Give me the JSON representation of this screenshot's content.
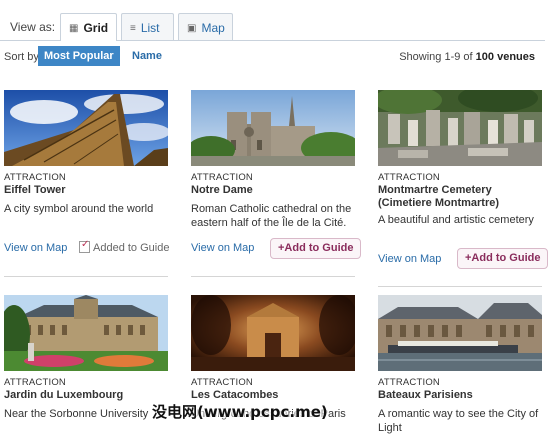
{
  "view": {
    "label": "View as:",
    "tabs": [
      {
        "label": "Grid",
        "icon": "grid-icon",
        "active": true
      },
      {
        "label": "List",
        "icon": "list-icon",
        "active": false
      },
      {
        "label": "Map",
        "icon": "map-icon",
        "active": false
      }
    ]
  },
  "sort": {
    "label": "Sort by:",
    "options": [
      {
        "label": "Most Popular",
        "active": true
      },
      {
        "label": "Name",
        "active": false
      }
    ]
  },
  "results": {
    "prefix": "Showing 1-9 of",
    "count": "100 venues"
  },
  "venues": [
    {
      "category": "ATTRACTION",
      "name": "Eiffel Tower",
      "description": "A city symbol around the world",
      "map_link": "View on Map",
      "guide": "Added to Guide",
      "in_guide": true
    },
    {
      "category": "ATTRACTION",
      "name": "Notre Dame",
      "description": "Roman Catholic cathedral on the eastern half of the Île de la Cité.",
      "map_link": "View on Map",
      "guide": "+Add to Guide",
      "in_guide": false
    },
    {
      "category": "ATTRACTION",
      "name": "Montmartre Cemetery (Cimetiere Montmartre)",
      "description": "A beautiful and artistic cemetery",
      "map_link": "View on Map",
      "guide": "+Add to Guide",
      "in_guide": false
    },
    {
      "category": "ATTRACTION",
      "name": "Jardin du Luxembourg",
      "description": "Near the Sorbonne University"
    },
    {
      "category": "ATTRACTION",
      "name": "Les Catacombes",
      "description": "Underground ossuaries of Paris"
    },
    {
      "category": "ATTRACTION",
      "name": "Bateaux Parisiens",
      "description": "A romantic way to see the City of Light"
    }
  ],
  "watermark": "没电网(www.pcpc.me)"
}
